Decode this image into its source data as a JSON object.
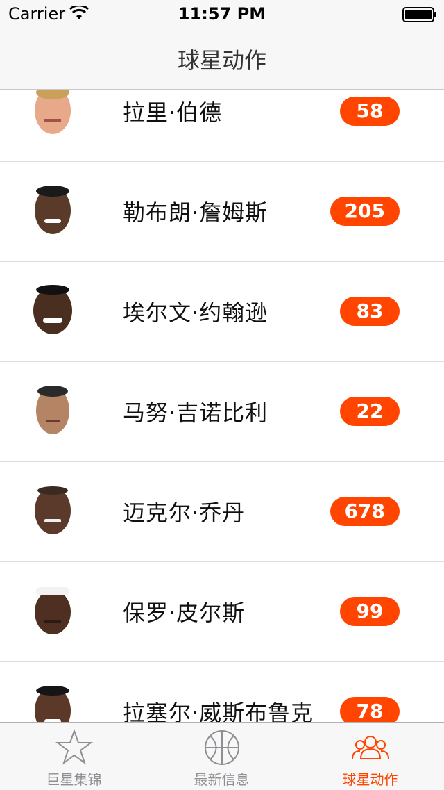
{
  "status_bar": {
    "carrier": "Carrier",
    "time": "11:57 PM"
  },
  "nav": {
    "title": "球星动作"
  },
  "players": [
    {
      "name": "拉里·伯德",
      "count": "58"
    },
    {
      "name": "勒布朗·詹姆斯",
      "count": "205"
    },
    {
      "name": "埃尔文·约翰逊",
      "count": "83"
    },
    {
      "name": "马努·吉诺比利",
      "count": "22"
    },
    {
      "name": "迈克尔·乔丹",
      "count": "678"
    },
    {
      "name": "保罗·皮尔斯",
      "count": "99"
    },
    {
      "name": "拉塞尔·威斯布鲁克",
      "count": "78"
    }
  ],
  "tabs": [
    {
      "label": "巨星集锦",
      "icon": "star-icon",
      "active": false
    },
    {
      "label": "最新信息",
      "icon": "basketball-icon",
      "active": false
    },
    {
      "label": "球星动作",
      "icon": "people-icon",
      "active": true
    }
  ],
  "colors": {
    "accent": "#ff4500",
    "inactive": "#8e8e93"
  }
}
